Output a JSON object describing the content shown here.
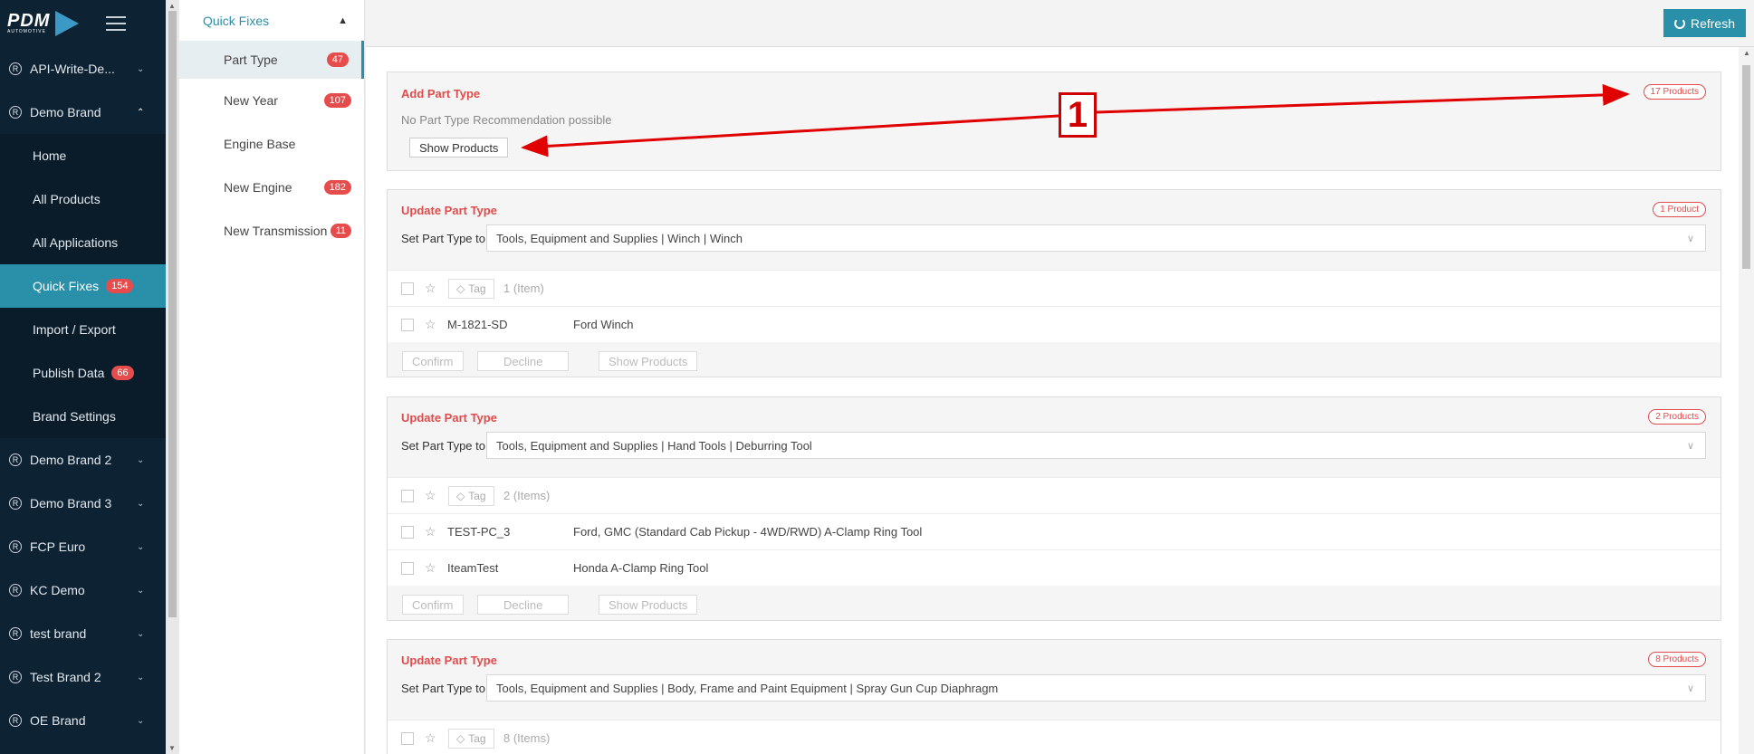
{
  "logo": {
    "text": "PDM",
    "sub": "AUTOMOTIVE"
  },
  "sidebar": {
    "items": [
      {
        "label": "API-Write-De..."
      },
      {
        "label": "Demo Brand"
      },
      {
        "label": "Home"
      },
      {
        "label": "All Products"
      },
      {
        "label": "All Applications"
      },
      {
        "label": "Quick Fixes",
        "badge": "154"
      },
      {
        "label": "Import / Export"
      },
      {
        "label": "Publish Data",
        "badge": "66"
      },
      {
        "label": "Brand Settings"
      },
      {
        "label": "Demo Brand 2"
      },
      {
        "label": "Demo Brand 3"
      },
      {
        "label": "FCP Euro"
      },
      {
        "label": "KC Demo"
      },
      {
        "label": "test brand"
      },
      {
        "label": "Test Brand 2"
      },
      {
        "label": "OE Brand"
      }
    ]
  },
  "quick_fixes": {
    "title": "Quick Fixes",
    "items": [
      {
        "label": "Part Type",
        "badge": "47"
      },
      {
        "label": "New Year",
        "badge": "107"
      },
      {
        "label": "Engine Base"
      },
      {
        "label": "New Engine",
        "badge": "182"
      },
      {
        "label": "New Transmission",
        "badge": "11"
      }
    ]
  },
  "topbar": {
    "refresh": "Refresh"
  },
  "cards": [
    {
      "title": "Add Part Type",
      "sub": "No Part Type Recommendation possible",
      "show_products": "Show Products",
      "pill": "17 Products"
    },
    {
      "title": "Update Part Type",
      "pill": "1 Product",
      "set_label": "Set Part Type to:",
      "select_value": "Tools, Equipment and Supplies | Winch | Winch",
      "tag": "Tag",
      "count": "1 (Item)",
      "rows": [
        {
          "sku": "M-1821-SD",
          "desc": "Ford Winch"
        }
      ],
      "confirm": "Confirm",
      "decline": "Decline",
      "show_products": "Show Products"
    },
    {
      "title": "Update Part Type",
      "pill": "2 Products",
      "set_label": "Set Part Type to:",
      "select_value": "Tools, Equipment and Supplies | Hand Tools | Deburring Tool",
      "tag": "Tag",
      "count": "2 (Items)",
      "rows": [
        {
          "sku": "TEST-PC_3",
          "desc": "Ford, GMC (Standard Cab Pickup - 4WD/RWD) A-Clamp Ring Tool"
        },
        {
          "sku": "IteamTest",
          "desc": "Honda A-Clamp Ring Tool"
        }
      ],
      "confirm": "Confirm",
      "decline": "Decline",
      "show_products": "Show Products"
    },
    {
      "title": "Update Part Type",
      "pill": "8 Products",
      "set_label": "Set Part Type to:",
      "select_value": "Tools, Equipment and Supplies | Body, Frame and Paint Equipment | Spray Gun Cup Diaphragm",
      "tag": "Tag",
      "count": "8 (Items)"
    }
  ],
  "annotation": {
    "label": "1",
    "color": "#d10000"
  }
}
